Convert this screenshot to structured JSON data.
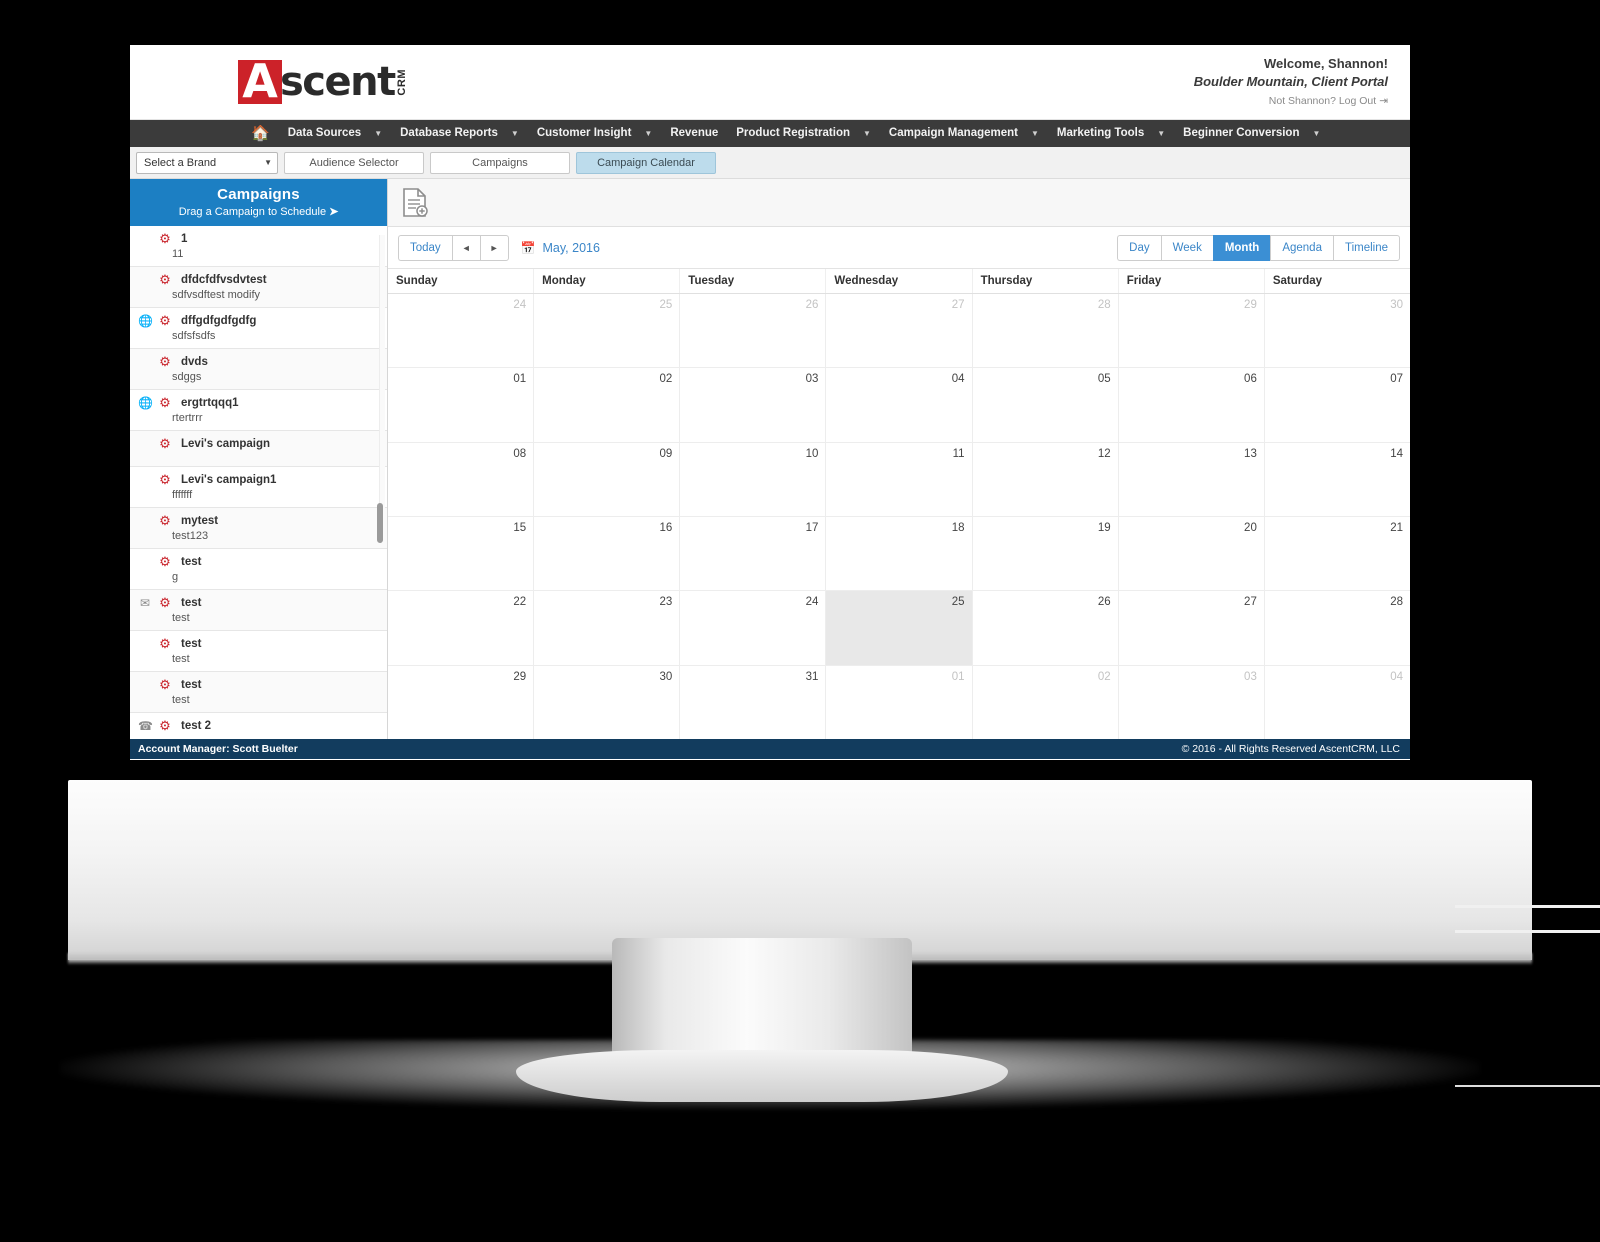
{
  "brand": {
    "logo_letter": "A",
    "logo_word": "scent",
    "logo_suffix": "CRM"
  },
  "header": {
    "welcome": "Welcome, Shannon!",
    "portal": "Boulder Mountain, Client Portal",
    "logout": "Not Shannon? Log Out",
    "logout_icon": "logout-icon"
  },
  "main_nav": {
    "home_icon": "home-icon",
    "items": [
      {
        "label": "Data Sources",
        "caret": true
      },
      {
        "label": "Database Reports",
        "caret": true
      },
      {
        "label": "Customer Insight",
        "caret": true
      },
      {
        "label": "Revenue",
        "caret": false
      },
      {
        "label": "Product Registration",
        "caret": true
      },
      {
        "label": "Campaign Management",
        "caret": true
      },
      {
        "label": "Marketing Tools",
        "caret": true
      },
      {
        "label": "Beginner Conversion",
        "caret": true
      }
    ]
  },
  "sub_toolbar": {
    "brand_select_value": "Select a Brand",
    "tabs": [
      {
        "label": "Audience Selector",
        "active": false
      },
      {
        "label": "Campaigns",
        "active": false
      },
      {
        "label": "Campaign Calendar",
        "active": true
      }
    ]
  },
  "sidebar": {
    "title": "Campaigns",
    "subtitle": "Drag a Campaign to Schedule",
    "subtitle_arrow": "➜",
    "campaigns": [
      {
        "name": "1",
        "desc": "11",
        "gear_icon": "gear-icon",
        "left_icon": ""
      },
      {
        "name": "dfdcfdfvsdvtest",
        "desc": "sdfvsdftest modify",
        "gear_icon": "gear-icon",
        "left_icon": ""
      },
      {
        "name": "dffgdfgdfgdfg",
        "desc": "sdfsfsdfs",
        "gear_icon": "gear-icon",
        "left_icon": "globe-icon"
      },
      {
        "name": "dvds",
        "desc": "sdggs",
        "gear_icon": "gear-icon",
        "left_icon": ""
      },
      {
        "name": "ergtrtqqq1",
        "desc": "rtertrrr",
        "gear_icon": "gear-icon",
        "left_icon": "globe-icon"
      },
      {
        "name": "Levi's campaign",
        "desc": "",
        "gear_icon": "gear-icon",
        "left_icon": ""
      },
      {
        "name": "Levi's campaign1",
        "desc": "fffffff",
        "gear_icon": "gear-icon",
        "left_icon": ""
      },
      {
        "name": "mytest",
        "desc": "test123",
        "gear_icon": "gear-icon",
        "left_icon": ""
      },
      {
        "name": "test",
        "desc": "g",
        "gear_icon": "gear-icon",
        "left_icon": ""
      },
      {
        "name": "test",
        "desc": "test",
        "gear_icon": "gear-icon",
        "left_icon": "mail-icon"
      },
      {
        "name": "test",
        "desc": "test",
        "gear_icon": "gear-icon",
        "left_icon": ""
      },
      {
        "name": "test",
        "desc": "test",
        "gear_icon": "gear-icon",
        "left_icon": ""
      },
      {
        "name": "test 2",
        "desc": "",
        "gear_icon": "gear-icon",
        "left_icon": "phone-icon"
      }
    ]
  },
  "calendar": {
    "add_icon": "document-add-icon",
    "today_label": "Today",
    "prev_label": "◄",
    "next_label": "►",
    "title_icon": "calendar-icon",
    "title": "May, 2016",
    "views": [
      {
        "label": "Day",
        "active": false
      },
      {
        "label": "Week",
        "active": false
      },
      {
        "label": "Month",
        "active": true
      },
      {
        "label": "Agenda",
        "active": false
      },
      {
        "label": "Timeline",
        "active": false
      }
    ],
    "day_names": [
      "Sunday",
      "Monday",
      "Tuesday",
      "Wednesday",
      "Thursday",
      "Friday",
      "Saturday"
    ],
    "weeks": [
      [
        {
          "d": "24",
          "other": true,
          "today": false
        },
        {
          "d": "25",
          "other": true,
          "today": false
        },
        {
          "d": "26",
          "other": true,
          "today": false
        },
        {
          "d": "27",
          "other": true,
          "today": false
        },
        {
          "d": "28",
          "other": true,
          "today": false
        },
        {
          "d": "29",
          "other": true,
          "today": false
        },
        {
          "d": "30",
          "other": true,
          "today": false
        }
      ],
      [
        {
          "d": "01",
          "other": false,
          "today": false
        },
        {
          "d": "02",
          "other": false,
          "today": false
        },
        {
          "d": "03",
          "other": false,
          "today": false
        },
        {
          "d": "04",
          "other": false,
          "today": false
        },
        {
          "d": "05",
          "other": false,
          "today": false
        },
        {
          "d": "06",
          "other": false,
          "today": false
        },
        {
          "d": "07",
          "other": false,
          "today": false
        }
      ],
      [
        {
          "d": "08",
          "other": false,
          "today": false
        },
        {
          "d": "09",
          "other": false,
          "today": false
        },
        {
          "d": "10",
          "other": false,
          "today": false
        },
        {
          "d": "11",
          "other": false,
          "today": false
        },
        {
          "d": "12",
          "other": false,
          "today": false
        },
        {
          "d": "13",
          "other": false,
          "today": false
        },
        {
          "d": "14",
          "other": false,
          "today": false
        }
      ],
      [
        {
          "d": "15",
          "other": false,
          "today": false
        },
        {
          "d": "16",
          "other": false,
          "today": false
        },
        {
          "d": "17",
          "other": false,
          "today": false
        },
        {
          "d": "18",
          "other": false,
          "today": false
        },
        {
          "d": "19",
          "other": false,
          "today": false
        },
        {
          "d": "20",
          "other": false,
          "today": false
        },
        {
          "d": "21",
          "other": false,
          "today": false
        }
      ],
      [
        {
          "d": "22",
          "other": false,
          "today": false
        },
        {
          "d": "23",
          "other": false,
          "today": false
        },
        {
          "d": "24",
          "other": false,
          "today": false
        },
        {
          "d": "25",
          "other": false,
          "today": true
        },
        {
          "d": "26",
          "other": false,
          "today": false
        },
        {
          "d": "27",
          "other": false,
          "today": false
        },
        {
          "d": "28",
          "other": false,
          "today": false
        }
      ],
      [
        {
          "d": "29",
          "other": false,
          "today": false
        },
        {
          "d": "30",
          "other": false,
          "today": false
        },
        {
          "d": "31",
          "other": false,
          "today": false
        },
        {
          "d": "01",
          "other": true,
          "today": false
        },
        {
          "d": "02",
          "other": true,
          "today": false
        },
        {
          "d": "03",
          "other": true,
          "today": false
        },
        {
          "d": "04",
          "other": true,
          "today": false
        }
      ]
    ]
  },
  "footer": {
    "left": "Account Manager: Scott Buelter",
    "right": "© 2016 - All Rights Reserved AscentCRM, LLC"
  },
  "colors": {
    "brand_red": "#cc2229",
    "nav_dark": "#3b3b3b",
    "sidebar_blue": "#1c7fc3",
    "accent_blue": "#3b8fd4",
    "footer_navy": "#123c5e",
    "tab_active": "#bddcec"
  }
}
